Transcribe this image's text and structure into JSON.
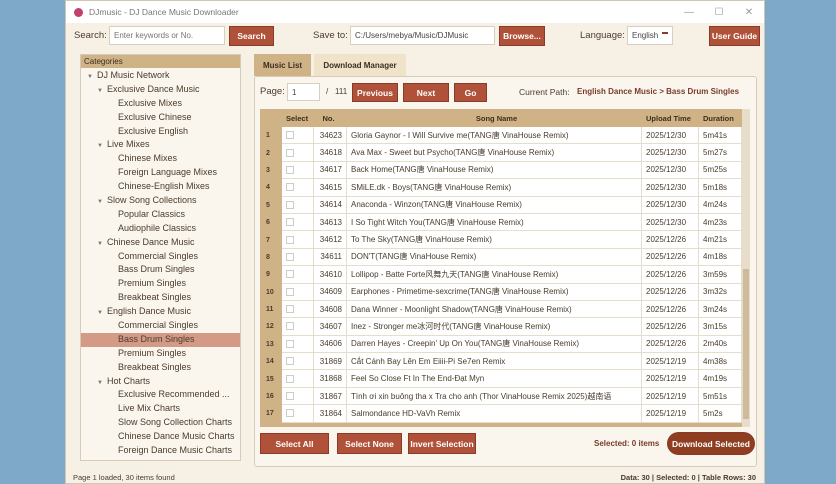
{
  "window": {
    "title": "DJmusic - DJ Dance Music Downloader",
    "minimize": "—",
    "maximize": "☐",
    "close": "✕"
  },
  "toolbar": {
    "search_label": "Search:",
    "search_placeholder": "Enter keywords or No.",
    "search_button": "Search",
    "save_label": "Save to:",
    "save_path": "C:/Users/mebya/Music/DJMusic",
    "browse_button": "Browse...",
    "language_label": "Language:",
    "language_value": "English",
    "guide_button": "User Guide"
  },
  "categories": {
    "header": "Categories",
    "nodes": [
      {
        "label": "DJ Music Network",
        "level": 0,
        "expanded": true
      },
      {
        "label": "Exclusive Dance Music",
        "level": 1,
        "expanded": true
      },
      {
        "label": "Exclusive Mixes",
        "level": 2
      },
      {
        "label": "Exclusive Chinese",
        "level": 2
      },
      {
        "label": "Exclusive English",
        "level": 2
      },
      {
        "label": "Live Mixes",
        "level": 1,
        "expanded": true
      },
      {
        "label": "Chinese Mixes",
        "level": 2
      },
      {
        "label": "Foreign Language Mixes",
        "level": 2
      },
      {
        "label": "Chinese-English Mixes",
        "level": 2
      },
      {
        "label": "Slow Song Collections",
        "level": 1,
        "expanded": true
      },
      {
        "label": "Popular Classics",
        "level": 2
      },
      {
        "label": "Audiophile Classics",
        "level": 2
      },
      {
        "label": "Chinese Dance Music",
        "level": 1,
        "expanded": true
      },
      {
        "label": "Commercial Singles",
        "level": 2
      },
      {
        "label": "Bass Drum Singles",
        "level": 2
      },
      {
        "label": "Premium Singles",
        "level": 2
      },
      {
        "label": "Breakbeat Singles",
        "level": 2
      },
      {
        "label": "English Dance Music",
        "level": 1,
        "expanded": true
      },
      {
        "label": "Commercial Singles",
        "level": 2
      },
      {
        "label": "Bass Drum Singles",
        "level": 2,
        "selected": true
      },
      {
        "label": "Premium Singles",
        "level": 2
      },
      {
        "label": "Breakbeat Singles",
        "level": 2
      },
      {
        "label": "Hot Charts",
        "level": 1,
        "expanded": true
      },
      {
        "label": "Exclusive Recommended ...",
        "level": 2
      },
      {
        "label": "Live Mix Charts",
        "level": 2
      },
      {
        "label": "Slow Song Collection Charts",
        "level": 2
      },
      {
        "label": "Chinese Dance Music Charts",
        "level": 2
      },
      {
        "label": "Foreign Dance Music Charts",
        "level": 2
      }
    ]
  },
  "tabs": [
    {
      "label": "Music List",
      "active": true
    },
    {
      "label": "Download Manager"
    }
  ],
  "pager": {
    "label": "Page:",
    "page": "1",
    "separator": "/",
    "total": "111",
    "previous": "Previous",
    "next": "Next",
    "go": "Go",
    "path_label": "Current Path:",
    "path_value": "English Dance Music > Bass Drum Singles"
  },
  "table": {
    "headers": [
      "Select",
      "No.",
      "Song Name",
      "Upload Time",
      "Duration"
    ],
    "rows": [
      [
        "1",
        "34623",
        "Gloria Gaynor - I Will Survive me(TANG唐 VinaHouse Remix)",
        "2025/12/30",
        "5m41s"
      ],
      [
        "2",
        "34618",
        "Ava Max - Sweet but Psycho(TANG唐 VinaHouse Remix)",
        "2025/12/30",
        "5m27s"
      ],
      [
        "3",
        "34617",
        "Back Home(TANG唐 VinaHouse Remix)",
        "2025/12/30",
        "5m25s"
      ],
      [
        "4",
        "34615",
        "SMiLE.dk - Boys(TANG唐 VinaHouse Remix)",
        "2025/12/30",
        "5m18s"
      ],
      [
        "5",
        "34614",
        "Anaconda - Winzon(TANG唐 VinaHouse Remix)",
        "2025/12/30",
        "4m24s"
      ],
      [
        "6",
        "34613",
        "I So Tight Witch You(TANG唐 VinaHouse Remix)",
        "2025/12/30",
        "4m23s"
      ],
      [
        "7",
        "34612",
        "To The Sky(TANG唐 VinaHouse Remix)",
        "2025/12/26",
        "4m21s"
      ],
      [
        "8",
        "34611",
        "DON'T(TANG唐 VinaHouse Remix)",
        "2025/12/26",
        "4m18s"
      ],
      [
        "9",
        "34610",
        "Lollipop - Batte Forte风舞九天(TANG唐 VinaHouse Remix)",
        "2025/12/26",
        "3m59s"
      ],
      [
        "10",
        "34609",
        "Earphones - Primetime-sexcrime(TANG唐 VinaHouse Remix)",
        "2025/12/26",
        "3m32s"
      ],
      [
        "11",
        "34608",
        "Dana Winner - Moonlight Shadow(TANG唐 VinaHouse Remix)",
        "2025/12/26",
        "3m24s"
      ],
      [
        "12",
        "34607",
        "Inez - Stronger me冰河时代(TANG唐 VinaHouse Remix)",
        "2025/12/26",
        "3m15s"
      ],
      [
        "13",
        "34606",
        "Darren Hayes - Creepin' Up On You(TANG唐 VinaHouse Remix)",
        "2025/12/26",
        "2m40s"
      ],
      [
        "14",
        "31869",
        "Cắt Cánh Bay Lên Em Eiiii-Pi Se7en Remix",
        "2025/12/19",
        "4m38s"
      ],
      [
        "15",
        "31868",
        "Feel So Close Ft In The End-Đạt Myn",
        "2025/12/19",
        "4m19s"
      ],
      [
        "16",
        "31867",
        "Tình ơi xin buông tha x Tra cho anh (Thor VinaHouse Remix 2025)越南语",
        "2025/12/19",
        "5m51s"
      ],
      [
        "17",
        "31864",
        "Salmondance HD-VaVh Remix",
        "2025/12/19",
        "5m2s"
      ]
    ]
  },
  "actions": {
    "select_all": "Select All",
    "select_none": "Select None",
    "invert": "Invert Selection",
    "selected_count": "Selected: 0 items",
    "download": "Download Selected"
  },
  "statusbar": {
    "left": "Page 1 loaded, 30 items found",
    "right": "Data: 30 | Selected: 0 | Table Rows: 30"
  },
  "colors": {
    "accent": "#b0523a",
    "tan": "#cfb387",
    "selected_row": "#d39a86",
    "download": "#8f3e22"
  }
}
